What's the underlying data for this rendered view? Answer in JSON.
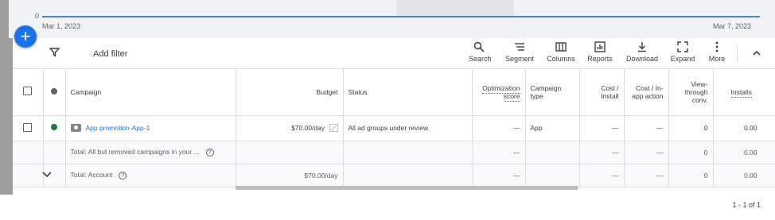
{
  "chart": {
    "zero_label": "0",
    "start_date": "Mar 1, 2023",
    "end_date": "Mar 7, 2023",
    "line_color": "#4a7fd4"
  },
  "fab": {
    "label": "+"
  },
  "toolbar": {
    "add_filter": "Add filter",
    "tools": [
      {
        "label": "Search",
        "icon": "search-icon"
      },
      {
        "label": "Segment",
        "icon": "segment-icon"
      },
      {
        "label": "Columns",
        "icon": "columns-icon"
      },
      {
        "label": "Reports",
        "icon": "reports-icon"
      },
      {
        "label": "Download",
        "icon": "download-icon"
      },
      {
        "label": "Expand",
        "icon": "expand-icon"
      },
      {
        "label": "More",
        "icon": "more-icon"
      }
    ]
  },
  "table": {
    "headers": {
      "campaign": "Campaign",
      "budget": "Budget",
      "status": "Status",
      "opt_score": "Optimization score",
      "campaign_type": "Campaign type",
      "cost_install": "Cost / Install",
      "cost_in_app": "Cost / In-app action",
      "view_through": "View-through conv.",
      "installs": "Installs"
    },
    "row": {
      "status_color": "#188038",
      "campaign": "App promotion-App-1",
      "budget": "$70.00/day",
      "status": "All ad groups under review",
      "opt_score": "—",
      "campaign_type": "App",
      "cost_install": "—",
      "cost_in_app": "—",
      "view_through": "0",
      "installs": "0.00"
    },
    "total_filtered": {
      "label": "Total: All but removed campaigns in your ...",
      "opt_score": "—",
      "cost_install": "—",
      "cost_in_app": "—",
      "view_through": "0",
      "installs": "0.00"
    },
    "total_account": {
      "label": "Total: Account",
      "budget": "$70.00/day",
      "opt_score": "—",
      "cost_install": "—",
      "cost_in_app": "—",
      "view_through": "0",
      "installs": "0.00"
    }
  },
  "pagination": "1 - 1 of 1"
}
